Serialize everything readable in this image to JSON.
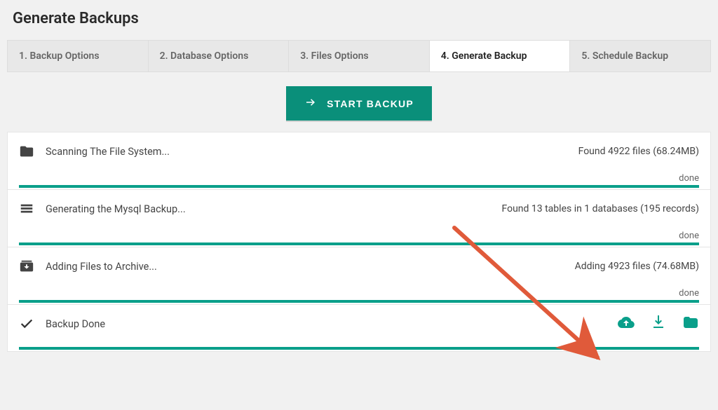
{
  "page_title": "Generate Backups",
  "tabs": [
    {
      "label": "1. Backup Options",
      "active": false
    },
    {
      "label": "2. Database Options",
      "active": false
    },
    {
      "label": "3. Files Options",
      "active": false
    },
    {
      "label": "4. Generate Backup",
      "active": true
    },
    {
      "label": "5. Schedule Backup",
      "active": false
    }
  ],
  "start_button": "START BACKUP",
  "steps": [
    {
      "title": "Scanning The File System...",
      "result": "Found 4922 files (68.24MB)",
      "status": "done"
    },
    {
      "title": "Generating the Mysql Backup...",
      "result": "Found 13 tables in 1 databases (195 records)",
      "status": "done"
    },
    {
      "title": "Adding Files to Archive...",
      "result": "Adding 4923 files (74.68MB)",
      "status": "done"
    },
    {
      "title": "Backup Done",
      "result": "",
      "status": ""
    }
  ],
  "done_label": "done"
}
